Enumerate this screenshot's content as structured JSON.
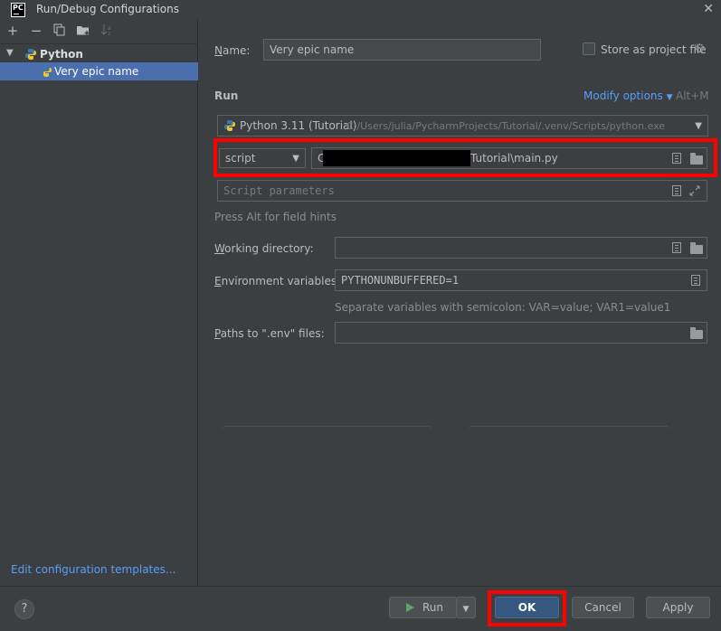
{
  "window": {
    "title": "Run/Debug Configurations",
    "app_icon": "PC"
  },
  "toolbar": {
    "add": "+",
    "remove": "−"
  },
  "tree": {
    "group_label": "Python",
    "item_label": "Very epic name"
  },
  "edit_templates_link": "Edit configuration templates...",
  "form": {
    "name_label": "Name:",
    "name_value": "Very epic name",
    "store_label": "Store as project file",
    "run_section": "Run",
    "modify_options": "Modify options",
    "modify_shortcut": "Alt+M",
    "interpreter_name": "Python 3.11 (Tutorial)",
    "interpreter_path": "C:/Users/julia/PycharmProjects/Tutorial/.venv/Scripts/python.exe",
    "script_type": "script",
    "script_path_prefix": "C",
    "script_path_suffix": "Tutorial\\main.py",
    "script_params_placeholder": "Script parameters",
    "alt_hint": "Press Alt for field hints",
    "working_dir_label": "Working directory:",
    "working_dir_value": "",
    "env_label": "Environment variables:",
    "env_value": "PYTHONUNBUFFERED=1",
    "env_hint": "Separate variables with semicolon: VAR=value; VAR1=value1",
    "dotenv_label": "Paths to \".env\" files:",
    "dotenv_value": ""
  },
  "buttons": {
    "help": "?",
    "run": "Run",
    "ok": "OK",
    "cancel": "Cancel",
    "apply": "Apply"
  },
  "colors": {
    "accent_link": "#589df6",
    "selection": "#4b6eaf",
    "highlight_box": "#ff0000",
    "primary_button": "#365880"
  }
}
